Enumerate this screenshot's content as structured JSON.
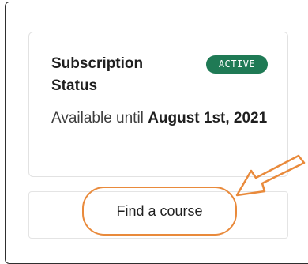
{
  "subscription": {
    "title": "Subscription Status",
    "status_badge": "ACTIVE",
    "availability_prefix": "Available until ",
    "availability_date": "August 1st, 2021"
  },
  "actions": {
    "find_course_label": "Find a course"
  },
  "colors": {
    "badge_bg": "#1f7a55",
    "annotation": "#e98a3b"
  },
  "icons": {
    "annotation_arrow": "arrow-pointing-down-left"
  }
}
